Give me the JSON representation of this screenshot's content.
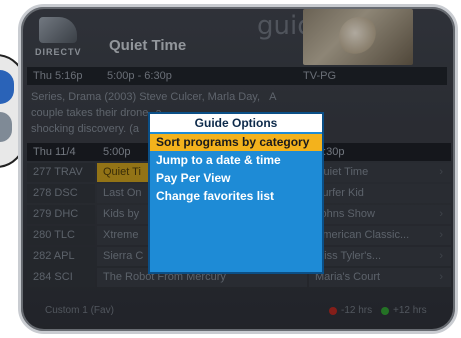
{
  "header": {
    "brand": "DIRECTV",
    "channel_title": "Quiet Time",
    "screen_word": "guide"
  },
  "infobar": {
    "date": "Thu 5:16p",
    "time_range": "5:00p - 6:30p",
    "rating": "TV-PG"
  },
  "description": {
    "line1": "Series, Drama (2003) Steve Culcer, Marla Day,",
    "line1_end": "A",
    "line2": "couple takes their drone",
    "line2_mid": "a",
    "line3": "shocking discovery. (a"
  },
  "grid": {
    "head": {
      "day": "Thu 11/4",
      "slot1": "5:00p",
      "slot2": "6:30p"
    },
    "rows": [
      {
        "channel": "277 TRAV",
        "prog1": "Quiet Ti",
        "prog2": "Quiet Time",
        "highlight": true
      },
      {
        "channel": "278 DSC",
        "prog1": "Last On",
        "prog2": "Surfer Kid",
        "highlight": false
      },
      {
        "channel": "279 DHC",
        "prog1": "Kids by",
        "prog2": "Johns Show",
        "highlight": false
      },
      {
        "channel": "280 TLC",
        "prog1": "Xtreme",
        "prog2": "American Classic...",
        "highlight": false
      },
      {
        "channel": "282 APL",
        "prog1": "Sierra C",
        "prog2": "Miss Tyler's...",
        "highlight": false
      },
      {
        "channel": "284 SCI",
        "prog1": "The Robot From Mercury",
        "prog2": "Maria's Court",
        "highlight": false
      }
    ]
  },
  "footer": {
    "label": "Custom 1 (Fav)",
    "minus": "-12 hrs",
    "plus": "+12 hrs"
  },
  "menu": {
    "title": "Guide Options",
    "items": [
      "Sort programs by category",
      "Jump to a date & time",
      "Pay Per View",
      "Change favorites list"
    ],
    "selected_index": 0
  },
  "colors": {
    "menu_bg": "#1e8bd6",
    "menu_selected": "#f3b21c",
    "highlight_program": "#c79b1a"
  },
  "icons": [
    "directv-logo-icon",
    "red-button-icon",
    "green-button-icon",
    "arrow-right-icon"
  ]
}
